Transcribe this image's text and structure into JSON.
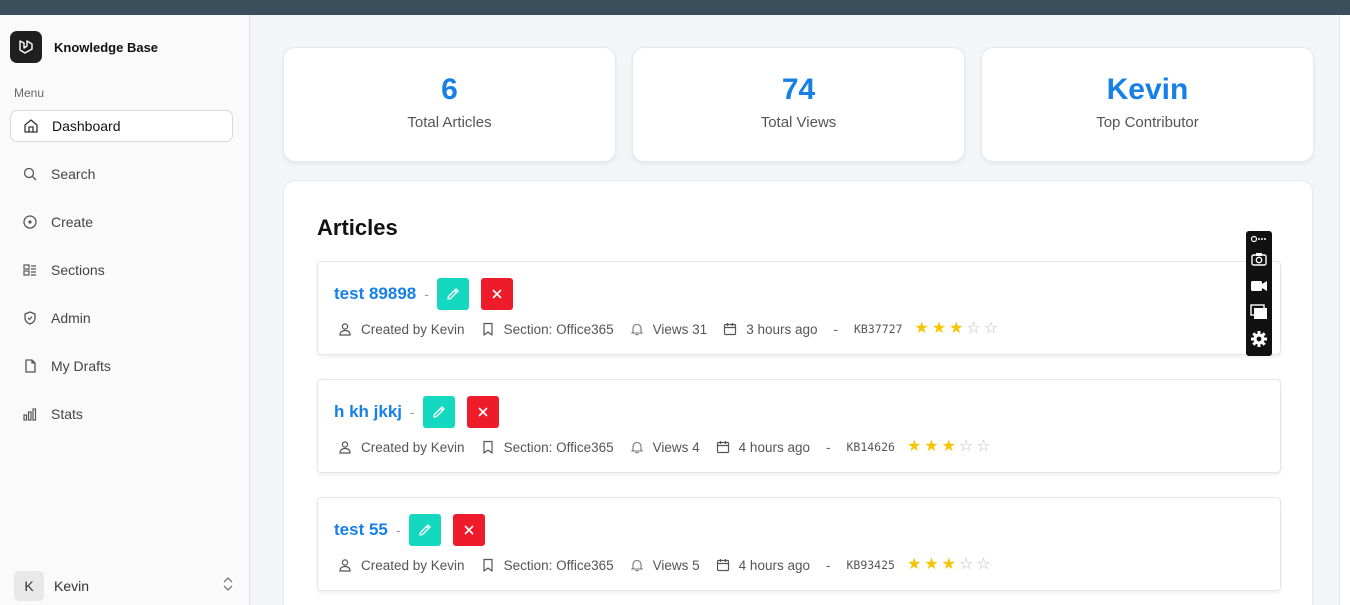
{
  "app": {
    "title": "Knowledge Base"
  },
  "sidebar": {
    "menu_heading": "Menu",
    "items": [
      {
        "label": "Dashboard",
        "icon": "home-icon",
        "active": true
      },
      {
        "label": "Search",
        "icon": "search-icon",
        "active": false
      },
      {
        "label": "Create",
        "icon": "plus-circle-icon",
        "active": false
      },
      {
        "label": "Sections",
        "icon": "sections-icon",
        "active": false
      },
      {
        "label": "Admin",
        "icon": "shield-icon",
        "active": false
      },
      {
        "label": "My Drafts",
        "icon": "file-icon",
        "active": false
      },
      {
        "label": "Stats",
        "icon": "bar-chart-icon",
        "active": false
      }
    ],
    "user": {
      "initial": "K",
      "name": "Kevin"
    }
  },
  "stats": [
    {
      "value": "6",
      "label": "Total Articles"
    },
    {
      "value": "74",
      "label": "Total Views"
    },
    {
      "value": "Kevin",
      "label": "Top Contributor"
    }
  ],
  "articles_section": {
    "title": "Articles",
    "separator": "-",
    "items": [
      {
        "title": "test 89898",
        "author": "Created by Kevin",
        "section": "Section: Office365",
        "views": "Views 31",
        "time": "3 hours ago",
        "id": "KB37727",
        "rating": 3,
        "max_rating": 5
      },
      {
        "title": "h kh jkkj",
        "author": "Created by Kevin",
        "section": "Section: Office365",
        "views": "Views 4",
        "time": "4 hours ago",
        "id": "KB14626",
        "rating": 3,
        "max_rating": 5
      },
      {
        "title": "test 55",
        "author": "Created by Kevin",
        "section": "Section: Office365",
        "views": "Views 5",
        "time": "4 hours ago",
        "id": "KB93425",
        "rating": 3,
        "max_rating": 5
      }
    ]
  },
  "colors": {
    "accent": "#1580e6",
    "edit_button": "#14d9c0",
    "delete_button": "#ee1b2a",
    "star": "#f7c400"
  }
}
